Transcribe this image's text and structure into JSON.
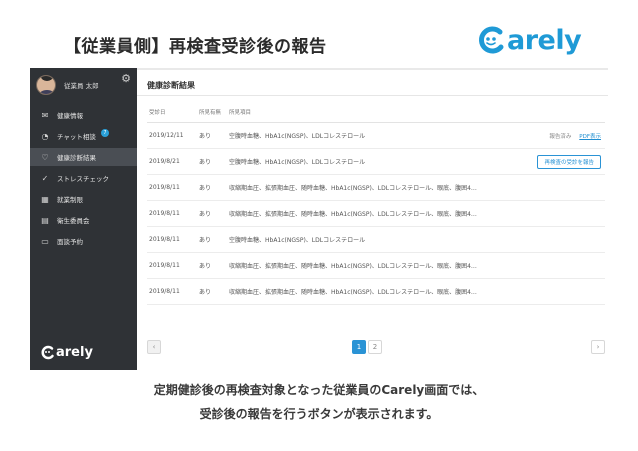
{
  "slide": {
    "title": "【従業員側】再検査受診後の報告",
    "brand": "arely",
    "caption_line1": "定期健診後の再検査対象となった従業員のCarely画面では、",
    "caption_line2": "受診後の報告を行うボタンが表示されます。"
  },
  "sidebar": {
    "user_name": "従業員 太郎",
    "items": [
      {
        "icon": "envelope-icon",
        "label": "健康情報"
      },
      {
        "icon": "chat-icon",
        "label": "チャット相談",
        "badge": "7"
      },
      {
        "icon": "heart-icon",
        "label": "健康診断結果"
      },
      {
        "icon": "check-icon",
        "label": "ストレスチェック"
      },
      {
        "icon": "calendar-icon",
        "label": "就業制限"
      },
      {
        "icon": "clipboard-icon",
        "label": "衛生委員会"
      },
      {
        "icon": "id-card-icon",
        "label": "面談予約"
      }
    ],
    "logo": "arely"
  },
  "main": {
    "page_title": "健康診断結果",
    "columns": [
      "受診日",
      "所見有無",
      "所見項目"
    ],
    "rows": [
      {
        "date": "2019/12/11",
        "flag": "あり",
        "items": "空腹時血糖、HbA1c(NGSP)、LDLコレステロール",
        "action": "done"
      },
      {
        "date": "2019/8/21",
        "flag": "あり",
        "items": "空腹時血糖、HbA1c(NGSP)、LDLコレステロール",
        "action": "report"
      },
      {
        "date": "2019/8/11",
        "flag": "あり",
        "items": "収縮期血圧、拡張期血圧、随時血糖、HbA1c(NGSP)、LDLコレステロール、眼底、腹囲4…",
        "action": ""
      },
      {
        "date": "2019/8/11",
        "flag": "あり",
        "items": "収縮期血圧、拡張期血圧、随時血糖、HbA1c(NGSP)、LDLコレステロール、眼底、腹囲4…",
        "action": ""
      },
      {
        "date": "2019/8/11",
        "flag": "あり",
        "items": "空腹時血糖、HbA1c(NGSP)、LDLコレステロール",
        "action": ""
      },
      {
        "date": "2019/8/11",
        "flag": "あり",
        "items": "収縮期血圧、拡張期血圧、随時血糖、HbA1c(NGSP)、LDLコレステロール、眼底、腹囲4…",
        "action": ""
      },
      {
        "date": "2019/8/11",
        "flag": "あり",
        "items": "収縮期血圧、拡張期血圧、随時血糖、HbA1c(NGSP)、LDLコレステロール、眼底、腹囲4…",
        "action": ""
      }
    ],
    "done_label": "報告済み",
    "pdf_label": "PDF表示",
    "report_label": "再検査の受診を報告",
    "pager": {
      "prev": "‹",
      "pages": [
        "1",
        "2"
      ],
      "next": "›",
      "current": "1"
    }
  },
  "colors": {
    "accent": "#2a93d5",
    "sidebar_bg": "#2f3236",
    "brand": "#1f9ad6"
  }
}
